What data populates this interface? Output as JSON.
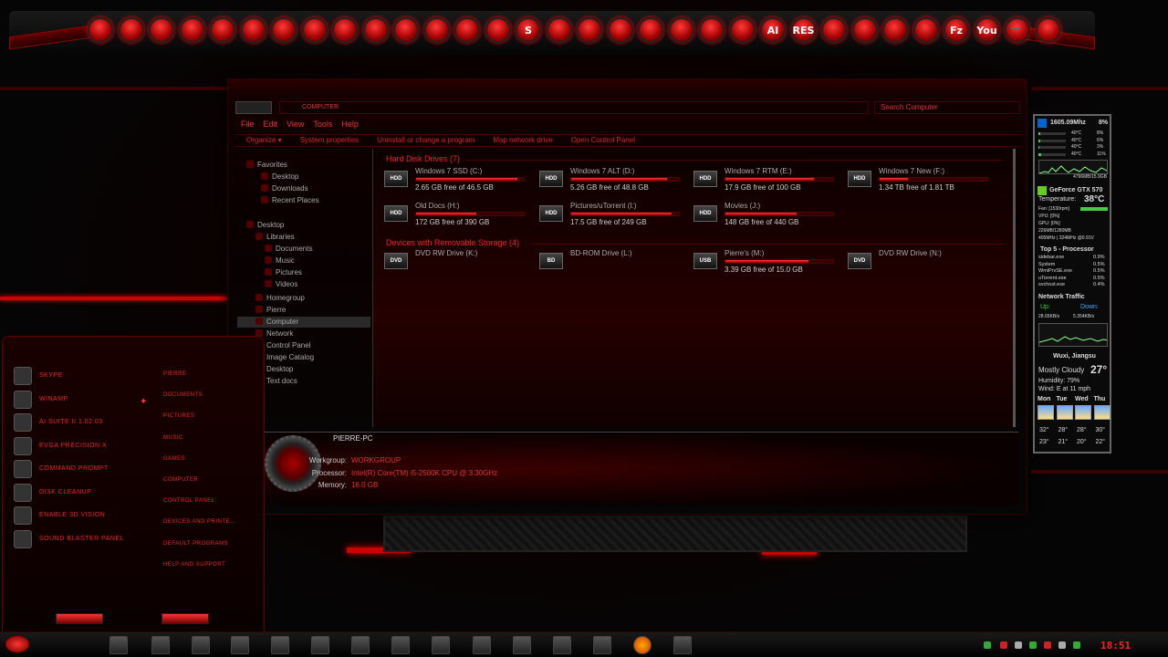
{
  "dock": {
    "icons": [
      "app-1",
      "app-2",
      "app-3",
      "app-4",
      "app-5",
      "app-6",
      "app-7",
      "app-8",
      "app-9",
      "app-10",
      "app-11",
      "app-12",
      "app-13",
      "app-14",
      "app-15",
      "app-16",
      "app-17",
      "app-18",
      "app-19",
      "app-20",
      "app-21",
      "app-22",
      "app-23",
      "app-24",
      "app-25",
      "app-26",
      "app-27",
      "app-28",
      "app-29",
      "app-30",
      "app-31",
      "app-32"
    ],
    "labels": {
      "ai": "AI",
      "res": "RES",
      "fz": "Fz",
      "you": "You",
      "s": "S"
    }
  },
  "explorer": {
    "address": "COMPUTER",
    "search_placeholder": "Search Computer",
    "menu": [
      "File",
      "Edit",
      "View",
      "Tools",
      "Help"
    ],
    "commands": [
      "Organize ▾",
      "System properties",
      "Uninstall or change a program",
      "Map network drive",
      "Open Control Panel"
    ],
    "nav": [
      {
        "label": "Favorites"
      },
      {
        "label": "Desktop"
      },
      {
        "label": "Downloads"
      },
      {
        "label": "Recent Places"
      },
      {
        "label": "Desktop"
      },
      {
        "label": "Libraries"
      },
      {
        "label": "Documents"
      },
      {
        "label": "Music"
      },
      {
        "label": "Pictures"
      },
      {
        "label": "Videos"
      },
      {
        "label": "Homegroup"
      },
      {
        "label": "Pierre"
      },
      {
        "label": "Computer"
      },
      {
        "label": "Network"
      },
      {
        "label": "Control Panel"
      },
      {
        "label": "Image Catalog"
      },
      {
        "label": "Desktop"
      },
      {
        "label": "Text docs"
      }
    ],
    "hdd_header": "Hard Disk Drives (7)",
    "removable_header": "Devices with Removable Storage (4)",
    "hdd": [
      {
        "icon": "HDD",
        "name": "Windows 7 SSD (C:)",
        "free": "2.65 GB free of 46.5 GB",
        "used": 0.94
      },
      {
        "icon": "HDD",
        "name": "Windows 7 ALT (D:)",
        "free": "5.26 GB free of 48.8 GB",
        "used": 0.89
      },
      {
        "icon": "HDD",
        "name": "Windows 7 RTM (E:)",
        "free": "17.9 GB free of 100 GB",
        "used": 0.82
      },
      {
        "icon": "HDD",
        "name": "Windows 7 New (F:)",
        "free": "1.34 TB free of 1.81 TB",
        "used": 0.26
      },
      {
        "icon": "HDD",
        "name": "Old Docs (H:)",
        "free": "172 GB free of 390 GB",
        "used": 0.56
      },
      {
        "icon": "HDD",
        "name": "Pictures/uTorrent (I:)",
        "free": "17.5 GB free of 249 GB",
        "used": 0.93
      },
      {
        "icon": "HDD",
        "name": "Movies (J:)",
        "free": "148 GB free of 440 GB",
        "used": 0.66
      }
    ],
    "removable": [
      {
        "icon": "DVD",
        "name": "DVD RW Drive (K:)",
        "free": ""
      },
      {
        "icon": "BD",
        "name": "BD-ROM Drive (L:)",
        "free": ""
      },
      {
        "icon": "USB",
        "name": "Pierre's (M:)",
        "free": "3.39 GB free of 15.0 GB",
        "used": 0.77
      },
      {
        "icon": "DVD",
        "name": "DVD RW Drive (N:)",
        "free": ""
      }
    ],
    "details": {
      "pc_name": "PIERRE-PC",
      "workgroup_label": "Workgroup:",
      "workgroup": "WORKGROUP",
      "processor_label": "Processor:",
      "processor": "Intel(R) Core(TM) i5-2500K CPU @ 3.30GHz",
      "memory_label": "Memory:",
      "memory": "16.0 GB"
    }
  },
  "startmenu": {
    "pinned": [
      "Skype",
      "Winamp",
      "AI Suite II 1.02.03",
      "EVGA Precision X",
      "Command Prompt",
      "Disk Cleanup",
      "Enable 3D Vision",
      "Sound Blaster Panel"
    ],
    "places": [
      "Pierre",
      "Documents",
      "Pictures",
      "Music",
      "Games",
      "Computer",
      "Control Panel",
      "Devices and Printe...",
      "Default Programs",
      "Help and Support"
    ]
  },
  "gadget": {
    "cpu_freq": "1605.09Mhz",
    "cpu_pct": "8%",
    "cores": [
      {
        "temp": "40°C",
        "pct": "8%",
        "fill": 0.08
      },
      {
        "temp": "40°C",
        "pct": "6%",
        "fill": 0.06
      },
      {
        "temp": "40°C",
        "pct": "3%",
        "fill": 0.03
      },
      {
        "temp": "40°C",
        "pct": "11%",
        "fill": 0.11
      }
    ],
    "mem": "4796MB/15.9GB",
    "gpu_name": "GeForce GTX 570",
    "temp_label": "Temperature:",
    "gpu_temp": "38°C",
    "fan": "Fan: [1530rpm]",
    "vpu": "VPU: [0%]",
    "gpu": "GPU: [0%]",
    "gpu_mem": "226MB/1280MB",
    "gpu_clock": "405MHz | 324MHz @0.91V",
    "top5_title": "Top 5 - Processor",
    "processes": [
      {
        "name": "sidebar.exe",
        "pct": "0.9%"
      },
      {
        "name": "System",
        "pct": "0.5%"
      },
      {
        "name": "WmiPrvSE.exe",
        "pct": "0.5%"
      },
      {
        "name": "uTorrent.exe",
        "pct": "0.5%"
      },
      {
        "name": "svchost.exe",
        "pct": "0.4%"
      }
    ],
    "net_title": "Network Traffic",
    "up_label": "Up:",
    "down_label": "Down:",
    "up_rate": "28.65KB/s",
    "down_rate": "5.354KB/s",
    "location": "Wuxi, Jiangsu",
    "condition": "Mostly Cloudy",
    "temp_now": "27°",
    "humidity": "Humidity: 79%",
    "wind": "Wind: E at 11 mph",
    "forecast": [
      {
        "day": "Mon",
        "high": "32°",
        "low": "23°"
      },
      {
        "day": "Tue",
        "high": "28°",
        "low": "21°"
      },
      {
        "day": "Wed",
        "high": "28°",
        "low": "20°"
      },
      {
        "day": "Thu",
        "high": "30°",
        "low": "22°"
      }
    ]
  },
  "taskbar": {
    "clock": "18:51"
  }
}
